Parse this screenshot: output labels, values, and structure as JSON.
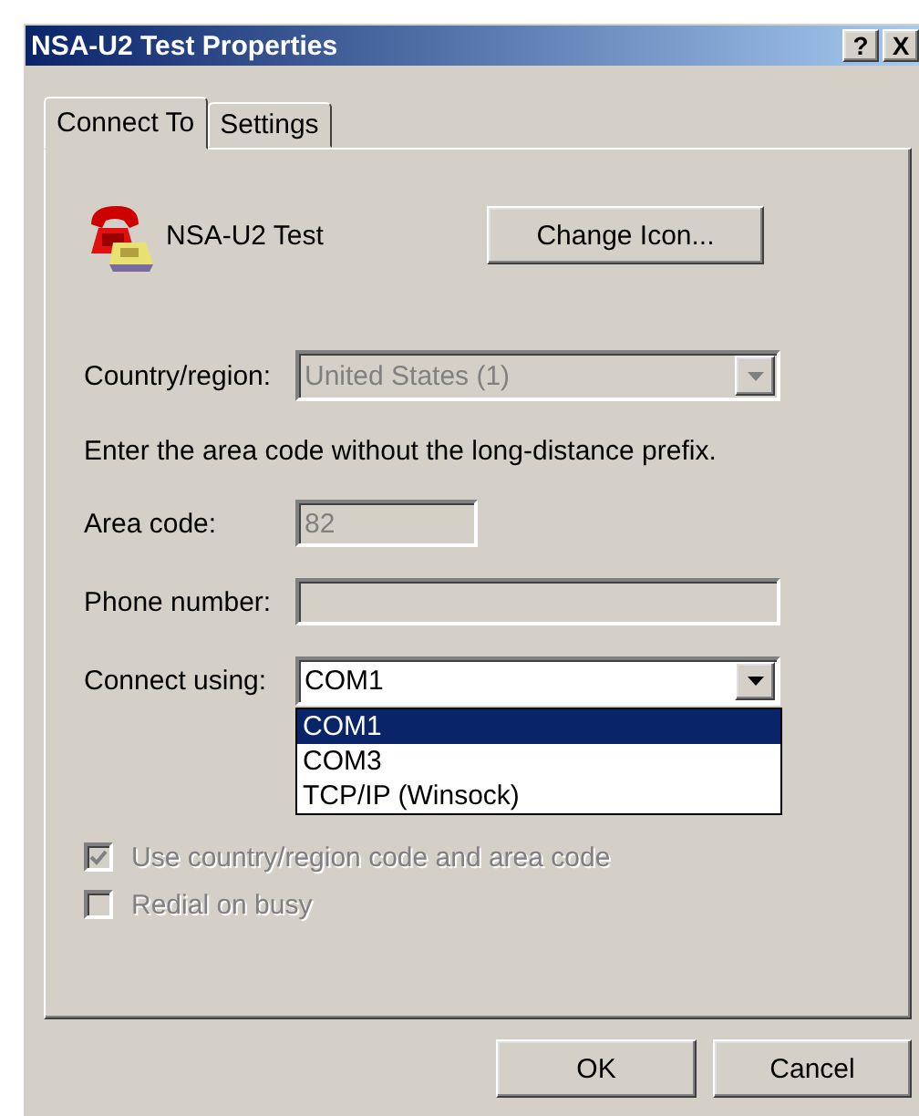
{
  "window": {
    "title": "NSA-U2 Test Properties",
    "buttons": [
      {
        "label": "?"
      },
      {
        "label": "X"
      }
    ]
  },
  "tabs": [
    {
      "label": "Connect To",
      "selected": true
    },
    {
      "label": "Settings",
      "selected": false
    }
  ],
  "entry": {
    "name": "NSA-U2 Test",
    "change_icon_button": "Change Icon..."
  },
  "country": {
    "label": "Country/region:",
    "value": "United States (1)",
    "disabled": true
  },
  "hint": "Enter the area code without the long-distance prefix.",
  "area_code": {
    "label": "Area code:",
    "value": "82",
    "disabled": true
  },
  "phone_number": {
    "label": "Phone number:",
    "disabled": true
  },
  "connect_using": {
    "label": "Connect using:",
    "value": "COM1",
    "expanded": true,
    "options": [
      {
        "label": "COM1",
        "selected": true
      },
      {
        "label": "COM3",
        "selected": false
      },
      {
        "label": "TCP/IP (Winsock)",
        "selected": false
      }
    ]
  },
  "checkboxes": [
    {
      "label": "Use country/region code and area code",
      "checked": true,
      "disabled": true
    },
    {
      "label": "Redial on busy",
      "checked": false,
      "disabled": true
    }
  ],
  "buttons": [
    "OK",
    "Cancel"
  ]
}
